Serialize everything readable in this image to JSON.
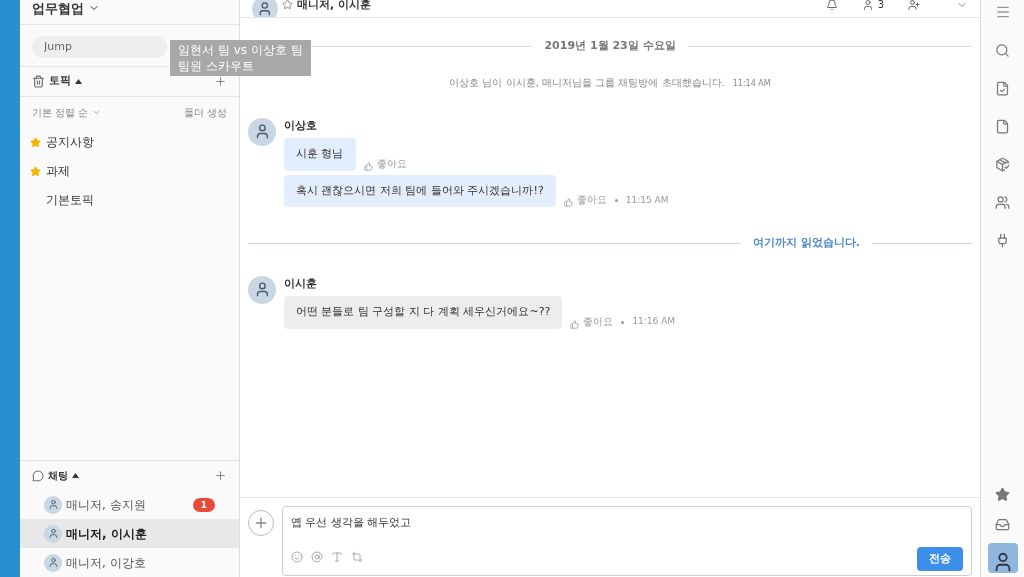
{
  "caption": {
    "lines": [
      "임현서 팀 vs 이상호 팀",
      "팀원 스카우트"
    ]
  },
  "sidebar": {
    "team_name": "업무협업",
    "search_placeholder": "Jump",
    "topics": {
      "title": "토픽",
      "expanded": true,
      "sort": "기본 정렬 순",
      "folder_action": "폴더 생성",
      "items": [
        {
          "label": "공지사항",
          "starred": true
        },
        {
          "label": "과제",
          "starred": true
        },
        {
          "label": "기본토픽",
          "starred": false
        }
      ]
    },
    "chats": {
      "title": "채팅",
      "expanded": true,
      "items": [
        {
          "label": "매니저, 송지원",
          "selected": false,
          "badge": "1"
        },
        {
          "label": "매니저, 이시훈",
          "selected": true
        },
        {
          "label": "매니저, 이강호",
          "selected": false
        }
      ]
    }
  },
  "header": {
    "title": "매니저, 이시훈",
    "member_count": "3"
  },
  "messages": [
    {
      "kind": "date",
      "text": "2019년 1월 23일 수요일"
    },
    {
      "kind": "system",
      "text": "이상호 님이 이시훈, 매니저님을 그룹 채팅방에 초대했습니다.",
      "time": "11:14 AM"
    },
    {
      "kind": "group",
      "sender": "이상호",
      "bubbles": [
        {
          "text": "시훈 형님",
          "like": "좋아요",
          "grey": false
        },
        {
          "text": "혹시 괜찮으시면 저희 팀에 들어와 주시겠습니까!?",
          "like": "좋아요",
          "time": "11:15 AM",
          "grey": false
        }
      ]
    },
    {
      "kind": "unread",
      "text": "여기까지 읽었습니다."
    },
    {
      "kind": "group",
      "sender": "이시훈",
      "bubbles": [
        {
          "text": "어떤 분들로 팀 구성할 지 다 계획 세우신거에요~??",
          "like": "좋아요",
          "time": "11:16 AM",
          "grey": true
        }
      ]
    }
  ],
  "composer": {
    "value": "옙 우선 생각을 해두었고",
    "send": "전송"
  }
}
